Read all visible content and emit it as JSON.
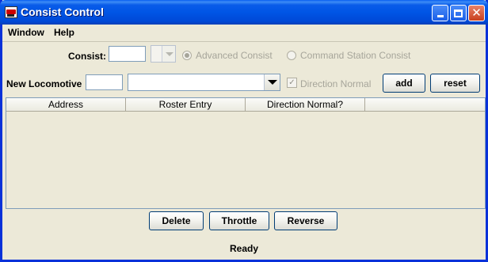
{
  "window": {
    "title": "Consist Control"
  },
  "menu": {
    "items": [
      {
        "label": "Window"
      },
      {
        "label": "Help"
      }
    ]
  },
  "consist": {
    "label": "Consist:",
    "address_value": "",
    "advanced_label": "Advanced Consist",
    "command_station_label": "Command Station Consist",
    "selected_type": "Advanced Consist"
  },
  "new_locomotive": {
    "label": "New Locomotive",
    "address_value": "",
    "roster_value": "",
    "direction_label": "Direction Normal",
    "direction_checked": true,
    "add_label": "add",
    "reset_label": "reset"
  },
  "table": {
    "columns": [
      "Address",
      "Roster Entry",
      "Direction Normal?",
      ""
    ],
    "rows": []
  },
  "actions": {
    "delete_label": "Delete",
    "throttle_label": "Throttle",
    "reverse_label": "Reverse"
  },
  "status": {
    "text": "Ready"
  },
  "icons": {
    "app": "locomotive-icon",
    "minimize": "minimize-icon",
    "maximize": "maximize-icon",
    "close": "close-icon",
    "dropdown": "chevron-down-icon",
    "check": "checkmark-icon"
  },
  "colors": {
    "titlebar": "#0055e5",
    "window_bg": "#ece9d8",
    "button_border": "#003c74",
    "disabled_text": "#a6a59a"
  }
}
